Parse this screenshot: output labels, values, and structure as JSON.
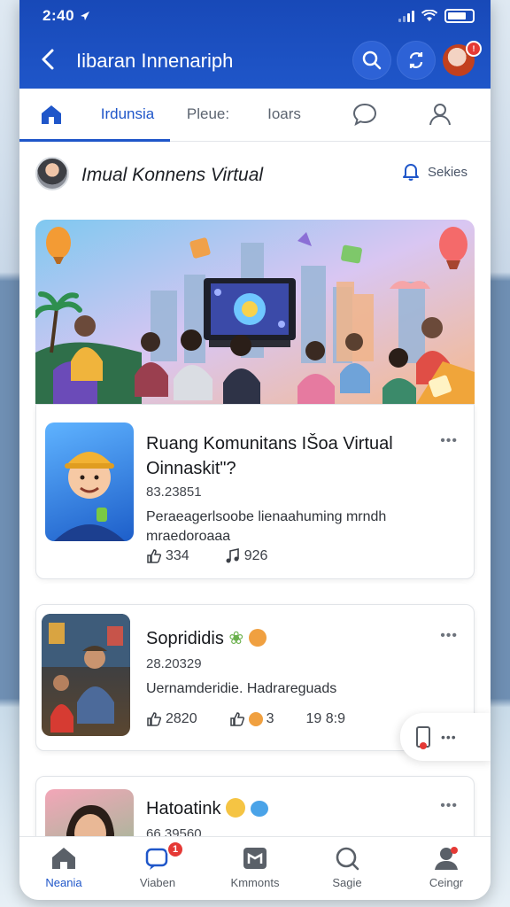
{
  "status_bar": {
    "time": "2:40"
  },
  "header": {
    "title": "Iibaran Innenariph"
  },
  "tabs": [
    {
      "label": ""
    },
    {
      "label": "Irdunsia"
    },
    {
      "label": "Pleue:"
    },
    {
      "label": "Ioars"
    },
    {
      "label": ""
    },
    {
      "label": ""
    }
  ],
  "community": {
    "title": "Imual Konnens Virtual",
    "action_label": "Sekies"
  },
  "cards": [
    {
      "title": "Ruang Komunitans IŠoa Virtual Oinnaskit\"?",
      "meta": "83.23851",
      "desc": "Peraeagerlsoobe lienaahuming mrndh mraedoroaaa",
      "likes": "334",
      "reactions": "926"
    },
    {
      "title": "Soprididis",
      "meta": "28.20329",
      "desc": "Uernamderidie. Hadrareguads",
      "stat1": "2820",
      "stat2": "3",
      "stat3": "19 8:9"
    },
    {
      "title": "Hatoatink",
      "meta": "66.39560"
    }
  ],
  "bottom_nav": [
    {
      "label": "Neania"
    },
    {
      "label": "Viaben",
      "badge": "1"
    },
    {
      "label": "Kmmonts"
    },
    {
      "label": "Sagie"
    },
    {
      "label": "Ceingr"
    }
  ],
  "colors": {
    "primary": "#1f56c9",
    "header_bg": "#1849b8",
    "badge": "#e53935"
  }
}
